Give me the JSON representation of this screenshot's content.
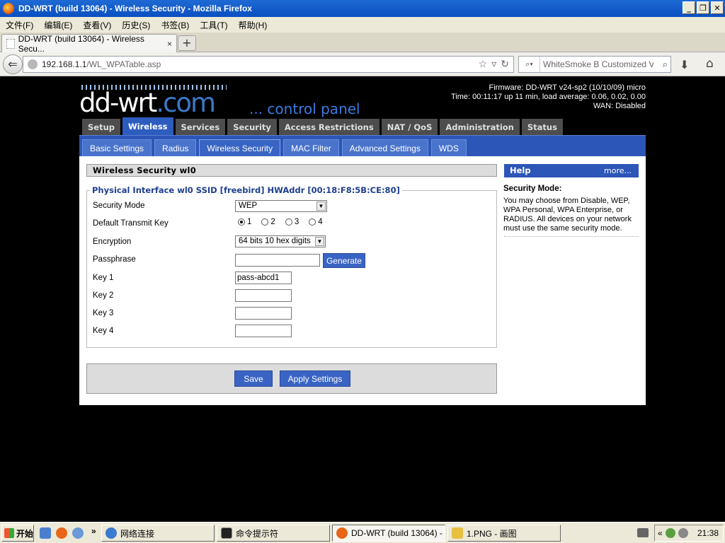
{
  "window": {
    "title": "DD-WRT (build 13064) - Wireless Security - Mozilla Firefox",
    "min": "_",
    "max": "❐",
    "close": "✕"
  },
  "menu": [
    "文件(F)",
    "编辑(E)",
    "查看(V)",
    "历史(S)",
    "书签(B)",
    "工具(T)",
    "帮助(H)"
  ],
  "tab": {
    "label": "DD-WRT (build 13064) - Wireless Secu...",
    "close": "×",
    "new": "+"
  },
  "nav": {
    "back": "⇐",
    "url_host": "192.168.1.1",
    "url_path": "/WL_WPATable.asp",
    "search_placeholder": "WhiteSmoke B Customized V",
    "download": "⬇",
    "home": "⌂"
  },
  "router": {
    "logo_main": "dd-wrt",
    "logo_com": ".com",
    "tagline": "... control panel",
    "firmware": "Firmware: DD-WRT v24-sp2 (10/10/09) micro",
    "time": "Time: 00:11:17 up 11 min, load average: 0.06, 0.02, 0.00",
    "wan": "WAN: Disabled"
  },
  "main_tabs": [
    "Setup",
    "Wireless",
    "Services",
    "Security",
    "Access Restrictions",
    "NAT / QoS",
    "Administration",
    "Status"
  ],
  "main_tab_active": "Wireless",
  "sub_tabs": [
    "Basic Settings",
    "Radius",
    "Wireless Security",
    "MAC Filter",
    "Advanced Settings",
    "WDS"
  ],
  "sub_tab_active": "Wireless Security",
  "section": {
    "title": "Wireless Security wl0",
    "legend": "Physical Interface wl0 SSID [freebird] HWAddr [00:18:F8:5B:CE:80]",
    "security_mode_label": "Security Mode",
    "security_mode_value": "WEP",
    "default_key_label": "Default Transmit Key",
    "default_key_options": [
      "1",
      "2",
      "3",
      "4"
    ],
    "default_key_selected": "1",
    "encryption_label": "Encryption",
    "encryption_value": "64 bits 10 hex digits",
    "passphrase_label": "Passphrase",
    "passphrase_value": "",
    "generate_label": "Generate",
    "key1_label": "Key 1",
    "key1_value": "pass-abcd1",
    "key2_label": "Key 2",
    "key2_value": "",
    "key3_label": "Key 3",
    "key3_value": "",
    "key4_label": "Key 4",
    "key4_value": "",
    "save_label": "Save",
    "apply_label": "Apply Settings"
  },
  "help": {
    "heading": "Help",
    "more": "more...",
    "title": "Security Mode:",
    "text": "You may choose from Disable, WEP, WPA Personal, WPA Enterprise, or RADIUS. All devices on your network must use the same security mode."
  },
  "taskbar": {
    "start": "开始",
    "chevron": "»",
    "items": [
      "网络连接",
      "命令提示符",
      "DD-WRT (build 13064) - ...",
      "1.PNG - 画图"
    ],
    "active_index": 2,
    "tray_chevron": "«",
    "clock": "21:38"
  },
  "colors": {
    "accent": "#2c56b7",
    "tab_inactive": "#4d4d4d",
    "page_bg": "#000000"
  }
}
